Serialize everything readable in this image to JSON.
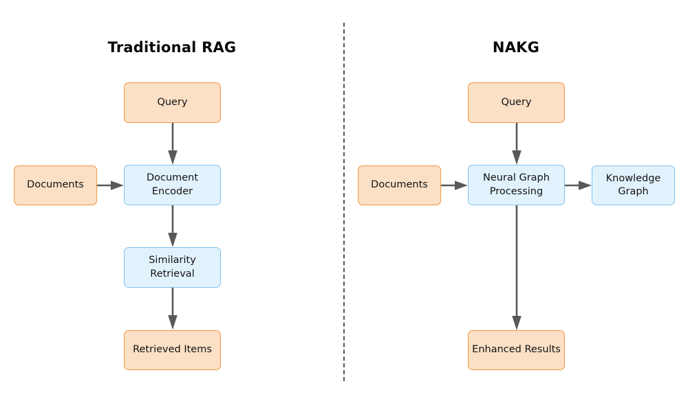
{
  "diagram": {
    "background": "#ffffff",
    "divider": {
      "name": "vertical-dashed-divider",
      "color": "#555555",
      "style": "dashed"
    },
    "colors": {
      "source_fill": "#fbe0c6",
      "source_border": "#f0963c",
      "process_fill": "#e2f2fd",
      "process_border": "#7ec2f0",
      "arrow": "#595959",
      "title_text": "#0a0a0a",
      "node_text": "#121212"
    },
    "panels": [
      {
        "id": "traditional-rag",
        "title": "Traditional RAG",
        "nodes": [
          {
            "id": "query",
            "label": "Query",
            "kind": "source"
          },
          {
            "id": "documents",
            "label": "Documents",
            "kind": "source"
          },
          {
            "id": "encoder",
            "label_line1": "Document",
            "label_line2": "Encoder",
            "kind": "process"
          },
          {
            "id": "similarity",
            "label_line1": "Similarity",
            "label_line2": "Retrieval",
            "kind": "process"
          },
          {
            "id": "retrieved",
            "label": "Retrieved Items",
            "kind": "source"
          }
        ],
        "edges": [
          {
            "from": "query",
            "to": "encoder",
            "direction": "down"
          },
          {
            "from": "documents",
            "to": "encoder",
            "direction": "right"
          },
          {
            "from": "encoder",
            "to": "similarity",
            "direction": "down"
          },
          {
            "from": "similarity",
            "to": "retrieved",
            "direction": "down"
          }
        ]
      },
      {
        "id": "nakg",
        "title": "NAKG",
        "nodes": [
          {
            "id": "query",
            "label": "Query",
            "kind": "source"
          },
          {
            "id": "documents",
            "label": "Documents",
            "kind": "source"
          },
          {
            "id": "neural",
            "label_line1": "Neural Graph",
            "label_line2": "Processing",
            "kind": "process"
          },
          {
            "id": "kg",
            "label_line1": "Knowledge",
            "label_line2": "Graph",
            "kind": "process"
          },
          {
            "id": "enhanced",
            "label": "Enhanced Results",
            "kind": "source"
          }
        ],
        "edges": [
          {
            "from": "query",
            "to": "neural",
            "direction": "down"
          },
          {
            "from": "documents",
            "to": "neural",
            "direction": "right"
          },
          {
            "from": "neural",
            "to": "kg",
            "direction": "right"
          },
          {
            "from": "neural",
            "to": "enhanced",
            "direction": "down"
          }
        ]
      }
    ]
  }
}
